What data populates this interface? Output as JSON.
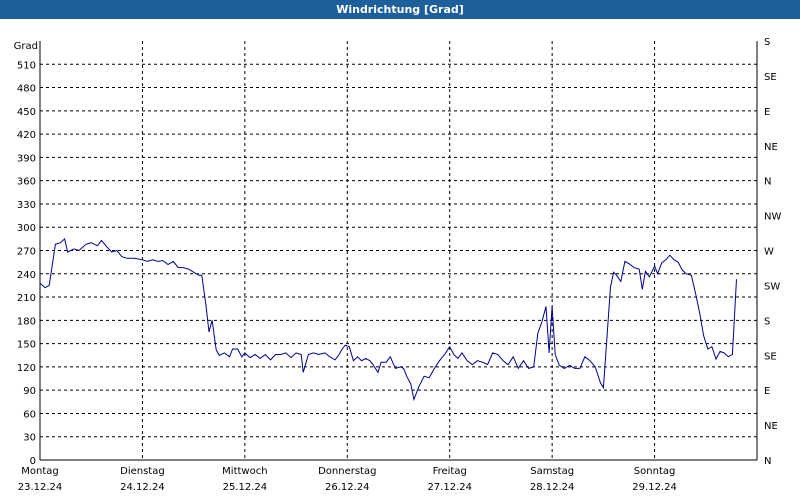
{
  "title": "Windrichtung [Grad]",
  "chart_data": {
    "type": "line",
    "title": "Windrichtung [Grad]",
    "ylabel": "Grad",
    "ylim": [
      0,
      540
    ],
    "grid": true,
    "yticks": [
      0,
      30,
      60,
      90,
      120,
      150,
      180,
      210,
      240,
      270,
      300,
      330,
      360,
      390,
      420,
      450,
      480,
      510
    ],
    "right_labels": [
      "N",
      "NE",
      "E",
      "SE",
      "S",
      "SW",
      "W",
      "NW",
      "N",
      "NE",
      "E",
      "SE",
      "S"
    ],
    "right_positions": [
      0,
      45,
      90,
      135,
      180,
      225,
      270,
      315,
      360,
      405,
      450,
      495,
      540
    ],
    "day_labels": [
      {
        "day": "Montag",
        "date": "23.12.24"
      },
      {
        "day": "Dienstag",
        "date": "24.12.24"
      },
      {
        "day": "Mittwoch",
        "date": "25.12.24"
      },
      {
        "day": "Donnerstag",
        "date": "26.12.24"
      },
      {
        "day": "Freitag",
        "date": "27.12.24"
      },
      {
        "day": "Samstag",
        "date": "28.12.24"
      },
      {
        "day": "Sonntag",
        "date": "29.12.24"
      }
    ],
    "x_unit": "days since Montag 23.12.24 00:00",
    "xlim": [
      0,
      7
    ],
    "series": [
      {
        "name": "Windrichtung",
        "color": "#00008b",
        "points": [
          [
            0.0,
            228
          ],
          [
            0.05,
            222
          ],
          [
            0.09,
            225
          ],
          [
            0.15,
            278
          ],
          [
            0.2,
            280
          ],
          [
            0.24,
            285
          ],
          [
            0.27,
            268
          ],
          [
            0.33,
            272
          ],
          [
            0.38,
            270
          ],
          [
            0.45,
            278
          ],
          [
            0.5,
            280
          ],
          [
            0.56,
            276
          ],
          [
            0.6,
            283
          ],
          [
            0.65,
            275
          ],
          [
            0.7,
            268
          ],
          [
            0.75,
            270
          ],
          [
            0.8,
            262
          ],
          [
            0.85,
            260
          ],
          [
            0.92,
            260
          ],
          [
            1.0,
            258
          ],
          [
            1.05,
            256
          ],
          [
            1.1,
            258
          ],
          [
            1.15,
            256
          ],
          [
            1.2,
            257
          ],
          [
            1.25,
            252
          ],
          [
            1.3,
            256
          ],
          [
            1.35,
            248
          ],
          [
            1.4,
            248
          ],
          [
            1.45,
            246
          ],
          [
            1.5,
            242
          ],
          [
            1.55,
            238
          ],
          [
            1.58,
            238
          ],
          [
            1.62,
            200
          ],
          [
            1.65,
            165
          ],
          [
            1.68,
            180
          ],
          [
            1.72,
            142
          ],
          [
            1.75,
            135
          ],
          [
            1.8,
            138
          ],
          [
            1.85,
            133
          ],
          [
            1.88,
            143
          ],
          [
            1.93,
            143
          ],
          [
            1.97,
            133
          ],
          [
            2.0,
            138
          ],
          [
            2.05,
            132
          ],
          [
            2.1,
            136
          ],
          [
            2.15,
            131
          ],
          [
            2.2,
            136
          ],
          [
            2.25,
            129
          ],
          [
            2.3,
            136
          ],
          [
            2.35,
            136
          ],
          [
            2.4,
            138
          ],
          [
            2.45,
            132
          ],
          [
            2.5,
            138
          ],
          [
            2.55,
            136
          ],
          [
            2.57,
            113
          ],
          [
            2.62,
            136
          ],
          [
            2.67,
            138
          ],
          [
            2.72,
            136
          ],
          [
            2.78,
            138
          ],
          [
            2.83,
            133
          ],
          [
            2.88,
            129
          ],
          [
            2.92,
            136
          ],
          [
            2.95,
            143
          ],
          [
            2.98,
            148
          ],
          [
            3.02,
            146
          ],
          [
            3.06,
            128
          ],
          [
            3.1,
            133
          ],
          [
            3.14,
            128
          ],
          [
            3.18,
            131
          ],
          [
            3.22,
            128
          ],
          [
            3.25,
            123
          ],
          [
            3.3,
            113
          ],
          [
            3.33,
            126
          ],
          [
            3.38,
            126
          ],
          [
            3.42,
            133
          ],
          [
            3.47,
            118
          ],
          [
            3.52,
            120
          ],
          [
            3.55,
            118
          ],
          [
            3.58,
            108
          ],
          [
            3.62,
            98
          ],
          [
            3.65,
            78
          ],
          [
            3.7,
            95
          ],
          [
            3.75,
            108
          ],
          [
            3.8,
            106
          ],
          [
            3.85,
            118
          ],
          [
            3.9,
            128
          ],
          [
            3.95,
            136
          ],
          [
            4.0,
            146
          ],
          [
            4.04,
            136
          ],
          [
            4.08,
            131
          ],
          [
            4.12,
            138
          ],
          [
            4.17,
            128
          ],
          [
            4.22,
            123
          ],
          [
            4.27,
            128
          ],
          [
            4.32,
            126
          ],
          [
            4.37,
            123
          ],
          [
            4.42,
            138
          ],
          [
            4.47,
            136
          ],
          [
            4.52,
            128
          ],
          [
            4.57,
            123
          ],
          [
            4.62,
            133
          ],
          [
            4.67,
            118
          ],
          [
            4.72,
            128
          ],
          [
            4.77,
            118
          ],
          [
            4.82,
            120
          ],
          [
            4.86,
            163
          ],
          [
            4.9,
            178
          ],
          [
            4.94,
            198
          ],
          [
            4.97,
            138
          ],
          [
            5.0,
            198
          ],
          [
            5.03,
            136
          ],
          [
            5.07,
            122
          ],
          [
            5.12,
            118
          ],
          [
            5.17,
            122
          ],
          [
            5.22,
            118
          ],
          [
            5.27,
            118
          ],
          [
            5.32,
            133
          ],
          [
            5.37,
            128
          ],
          [
            5.42,
            120
          ],
          [
            5.47,
            100
          ],
          [
            5.5,
            93
          ],
          [
            5.54,
            168
          ],
          [
            5.57,
            223
          ],
          [
            5.6,
            242
          ],
          [
            5.63,
            238
          ],
          [
            5.67,
            230
          ],
          [
            5.71,
            256
          ],
          [
            5.75,
            253
          ],
          [
            5.8,
            248
          ],
          [
            5.85,
            246
          ],
          [
            5.88,
            220
          ],
          [
            5.91,
            243
          ],
          [
            5.95,
            236
          ],
          [
            6.0,
            250
          ],
          [
            6.03,
            240
          ],
          [
            6.07,
            254
          ],
          [
            6.11,
            258
          ],
          [
            6.15,
            264
          ],
          [
            6.19,
            258
          ],
          [
            6.23,
            255
          ],
          [
            6.27,
            245
          ],
          [
            6.31,
            240
          ],
          [
            6.36,
            238
          ],
          [
            6.4,
            215
          ],
          [
            6.44,
            190
          ],
          [
            6.48,
            160
          ],
          [
            6.52,
            143
          ],
          [
            6.56,
            146
          ],
          [
            6.6,
            130
          ],
          [
            6.64,
            140
          ],
          [
            6.68,
            138
          ],
          [
            6.72,
            133
          ],
          [
            6.76,
            136
          ],
          [
            6.8,
            233
          ]
        ]
      }
    ]
  }
}
